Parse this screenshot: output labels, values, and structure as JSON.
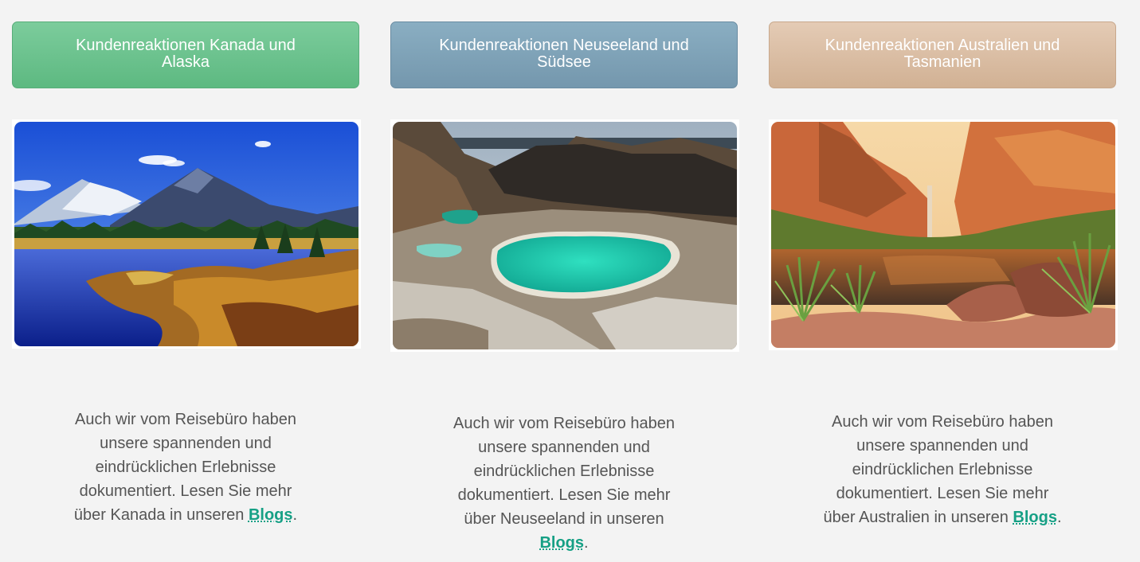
{
  "columns": [
    {
      "button_label": "Kundenreaktionen Kanada und Alaska",
      "image_alt": "Berglandschaft mit See in Kanada",
      "caption_before_link": "Auch wir vom Reisebüro haben unsere spannenden und eindrücklichen Erlebnisse dokumentiert. Lesen Sie mehr über Kanada in unseren",
      "link_label": "Blogs",
      "caption_after_link": "."
    },
    {
      "button_label": "Kundenreaktionen Neuseeland und Südsee",
      "image_alt": "Vulkanlandschaft mit türkisem Kratersee in Neuseeland",
      "caption_before_link": "Auch wir vom Reisebüro haben unsere spannenden und eindrücklichen Erlebnisse dokumentiert. Lesen Sie mehr über Neuseeland in unseren",
      "link_label": "Blogs",
      "caption_after_link": "."
    },
    {
      "button_label": "Kundenreaktionen Australien und Tasmanien",
      "image_alt": "Schlucht mit Wasserfall und Wasserloch in Australien",
      "caption_before_link": "Auch wir vom Reisebüro haben unsere spannenden und eindrücklichen Erlebnisse dokumentiert. Lesen Sie mehr über Australien in unseren",
      "link_label": "Blogs",
      "caption_after_link": "."
    }
  ],
  "colors": {
    "green_button": "#6cc38f",
    "blue_button": "#7fa2b8",
    "tan_button": "#dbbfa5",
    "link": "#16a085",
    "text": "#555555",
    "background": "#f3f3f3"
  }
}
